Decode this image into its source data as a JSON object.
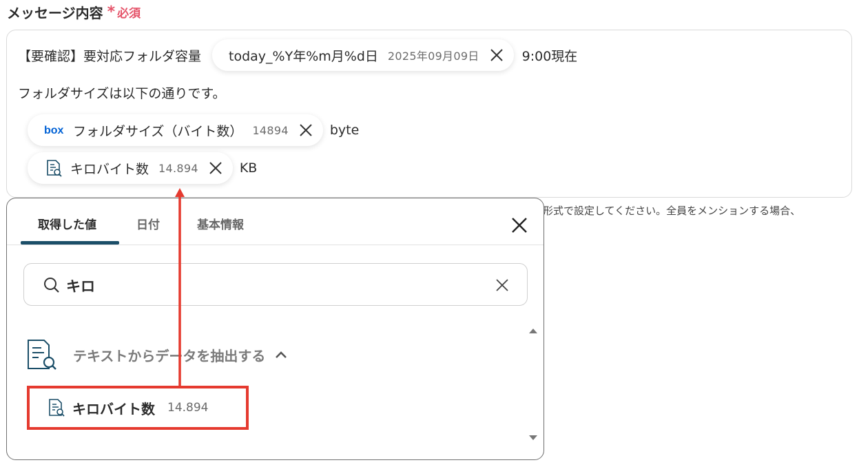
{
  "field": {
    "label": "メッセージ内容",
    "required": "必須"
  },
  "message": {
    "line1_prefix": "【要確認】要対応フォルダ容量",
    "line1_chip": {
      "label": "today_%Y年%m月%d日",
      "value": "2025年09月09日"
    },
    "line1_suffix": "9:00現在",
    "line2": "フォルダサイズは以下の通りです。",
    "line3_chip": {
      "icon": "box-logo-icon",
      "logo_text": "box",
      "label": "フォルダサイズ（バイト数）",
      "value": "14894"
    },
    "line3_suffix": "byte",
    "line4_chip": {
      "icon": "document-search-icon",
      "label": "キロバイト数",
      "value": "14.894"
    },
    "line4_suffix": "KB"
  },
  "helper_text": "形式で設定してください。全員をメンションする場合、",
  "panel": {
    "tabs": [
      {
        "label": "取得した値",
        "active": true
      },
      {
        "label": "日付",
        "active": false
      },
      {
        "label": "基本情報",
        "active": false
      }
    ],
    "search": {
      "value": "キロ"
    },
    "group": {
      "label": "テキストからデータを抽出する",
      "icon": "document-search-icon",
      "expanded": true
    },
    "results": [
      {
        "label": "キロバイト数",
        "value": "14.894",
        "highlighted": true
      }
    ]
  },
  "colors": {
    "accent": "#1b4e68",
    "required": "#e5546a",
    "highlight": "#e53a2f",
    "box_blue": "#0061d5"
  }
}
